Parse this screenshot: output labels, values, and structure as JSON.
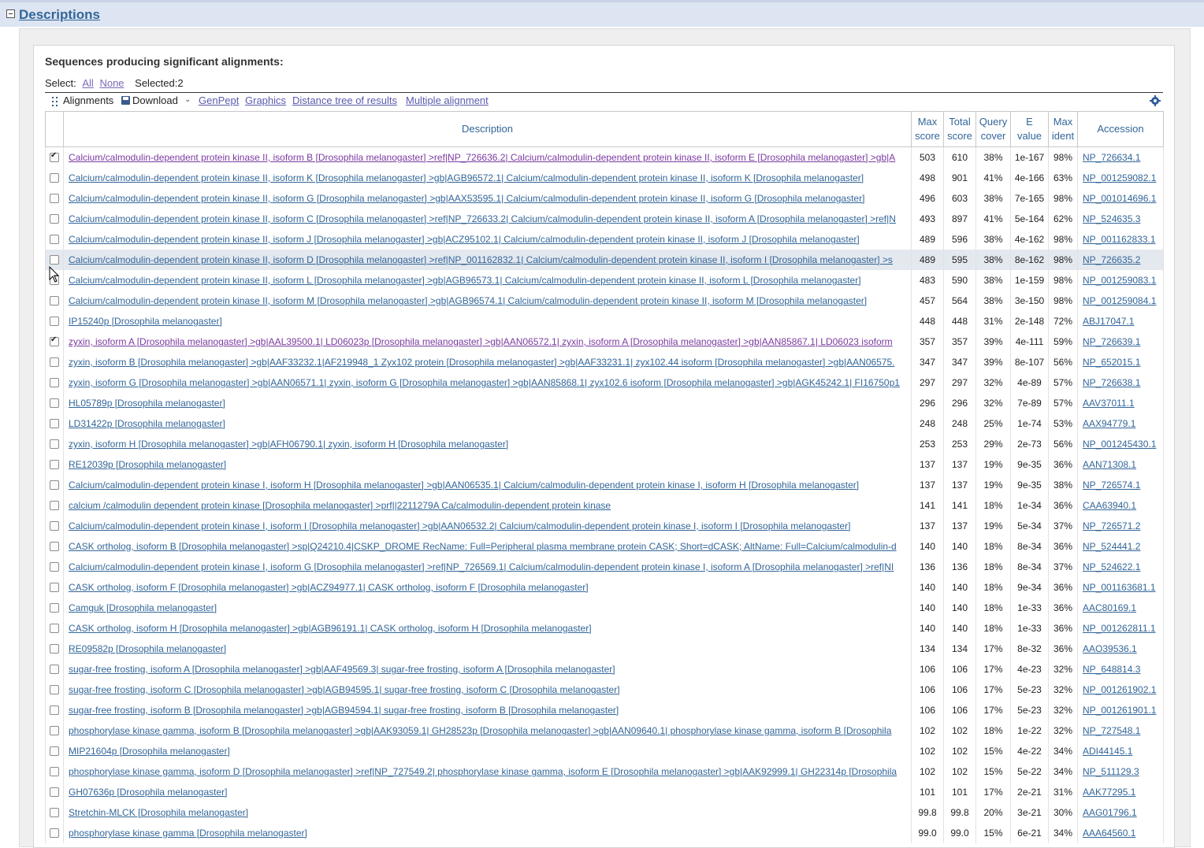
{
  "section": {
    "title": "Descriptions"
  },
  "heading": "Sequences producing significant alignments:",
  "select": {
    "label": "Select:",
    "all": "All",
    "none": "None",
    "selected": "Selected:2"
  },
  "toolbar": {
    "alignments": "Alignments",
    "download": "Download",
    "genpept": "GenPept",
    "graphics": "Graphics",
    "distance_tree": "Distance tree of results",
    "multiple_alignment": "Multiple alignment"
  },
  "columns": {
    "description": "Description",
    "max_score_1": "Max",
    "max_score_2": "score",
    "total_score_1": "Total",
    "total_score_2": "score",
    "query_cover_1": "Query",
    "query_cover_2": "cover",
    "evalue_1": "E",
    "evalue_2": "value",
    "max_ident_1": "Max",
    "max_ident_2": "ident",
    "accession": "Accession"
  },
  "rows": [
    {
      "checked": true,
      "desc": "Calcium/calmodulin-dependent protein kinase II, isoform B [Drosophila melanogaster] >ref|NP_726636.2| Calcium/calmodulin-dependent protein kinase II, isoform E [Drosophila melanogaster] >gb|A",
      "max": "503",
      "total": "610",
      "cover": "38%",
      "e": "1e-167",
      "ident": "98%",
      "acc": "NP_726634.1"
    },
    {
      "checked": false,
      "desc": "Calcium/calmodulin-dependent protein kinase II, isoform K [Drosophila melanogaster] >gb|AGB96572.1| Calcium/calmodulin-dependent protein kinase II, isoform K [Drosophila melanogaster]",
      "max": "498",
      "total": "901",
      "cover": "41%",
      "e": "4e-166",
      "ident": "63%",
      "acc": "NP_001259082.1"
    },
    {
      "checked": false,
      "desc": "Calcium/calmodulin-dependent protein kinase II, isoform G [Drosophila melanogaster] >gb|AAX53595.1| Calcium/calmodulin-dependent protein kinase II, isoform G [Drosophila melanogaster]",
      "max": "496",
      "total": "603",
      "cover": "38%",
      "e": "7e-165",
      "ident": "98%",
      "acc": "NP_001014696.1"
    },
    {
      "checked": false,
      "desc": "Calcium/calmodulin-dependent protein kinase II, isoform C [Drosophila melanogaster] >ref|NP_726633.2| Calcium/calmodulin-dependent protein kinase II, isoform A [Drosophila melanogaster] >ref|N",
      "max": "493",
      "total": "897",
      "cover": "41%",
      "e": "5e-164",
      "ident": "62%",
      "acc": "NP_524635.3"
    },
    {
      "checked": false,
      "desc": "Calcium/calmodulin-dependent protein kinase II, isoform J [Drosophila melanogaster] >gb|ACZ95102.1| Calcium/calmodulin-dependent protein kinase II, isoform J [Drosophila melanogaster]",
      "max": "489",
      "total": "596",
      "cover": "38%",
      "e": "4e-162",
      "ident": "98%",
      "acc": "NP_001162833.1"
    },
    {
      "checked": false,
      "hl": true,
      "desc": "Calcium/calmodulin-dependent protein kinase II, isoform D [Drosophila melanogaster] >ref|NP_001162832.1| Calcium/calmodulin-dependent protein kinase II, isoform I [Drosophila melanogaster] >s",
      "max": "489",
      "total": "595",
      "cover": "38%",
      "e": "8e-162",
      "ident": "98%",
      "acc": "NP_726635.2"
    },
    {
      "checked": false,
      "desc": "Calcium/calmodulin-dependent protein kinase II, isoform L [Drosophila melanogaster] >gb|AGB96573.1| Calcium/calmodulin-dependent protein kinase II, isoform L [Drosophila melanogaster]",
      "max": "483",
      "total": "590",
      "cover": "38%",
      "e": "1e-159",
      "ident": "98%",
      "acc": "NP_001259083.1"
    },
    {
      "checked": false,
      "desc": "Calcium/calmodulin-dependent protein kinase II, isoform M [Drosophila melanogaster] >gb|AGB96574.1| Calcium/calmodulin-dependent protein kinase II, isoform M [Drosophila melanogaster]",
      "max": "457",
      "total": "564",
      "cover": "38%",
      "e": "3e-150",
      "ident": "98%",
      "acc": "NP_001259084.1"
    },
    {
      "checked": false,
      "desc": "IP15240p [Drosophila melanogaster]",
      "max": "448",
      "total": "448",
      "cover": "31%",
      "e": "2e-148",
      "ident": "72%",
      "acc": "ABJ17047.1"
    },
    {
      "checked": true,
      "desc": "zyxin, isoform A [Drosophila melanogaster] >gb|AAL39500.1| LD06023p [Drosophila melanogaster] >gb|AAN06572.1| zyxin, isoform A [Drosophila melanogaster] >gb|AAN85867.1| LD06023 isoform",
      "max": "357",
      "total": "357",
      "cover": "39%",
      "e": "4e-111",
      "ident": "59%",
      "acc": "NP_726639.1"
    },
    {
      "checked": false,
      "desc": "zyxin, isoform B [Drosophila melanogaster] >gb|AAF33232.1|AF219948_1 Zyx102 protein [Drosophila melanogaster] >gb|AAF33231.1| zyx102.44 isoform [Drosophila melanogaster] >gb|AAN06575.",
      "max": "347",
      "total": "347",
      "cover": "39%",
      "e": "8e-107",
      "ident": "56%",
      "acc": "NP_652015.1"
    },
    {
      "checked": false,
      "desc": "zyxin, isoform G [Drosophila melanogaster] >gb|AAN06571.1| zyxin, isoform G [Drosophila melanogaster] >gb|AAN85868.1| zyx102.6 isoform [Drosophila melanogaster] >gb|AGK45242.1| FI16750p1",
      "max": "297",
      "total": "297",
      "cover": "32%",
      "e": "4e-89",
      "ident": "57%",
      "acc": "NP_726638.1"
    },
    {
      "checked": false,
      "desc": "HL05789p [Drosophila melanogaster]",
      "max": "296",
      "total": "296",
      "cover": "32%",
      "e": "7e-89",
      "ident": "57%",
      "acc": "AAV37011.1"
    },
    {
      "checked": false,
      "desc": "LD31422p [Drosophila melanogaster]",
      "max": "248",
      "total": "248",
      "cover": "25%",
      "e": "1e-74",
      "ident": "53%",
      "acc": "AAX94779.1"
    },
    {
      "checked": false,
      "desc": "zyxin, isoform H [Drosophila melanogaster] >gb|AFH06790.1| zyxin, isoform H [Drosophila melanogaster]",
      "max": "253",
      "total": "253",
      "cover": "29%",
      "e": "2e-73",
      "ident": "56%",
      "acc": "NP_001245430.1"
    },
    {
      "checked": false,
      "desc": "RE12039p [Drosophila melanogaster]",
      "max": "137",
      "total": "137",
      "cover": "19%",
      "e": "9e-35",
      "ident": "36%",
      "acc": "AAN71308.1"
    },
    {
      "checked": false,
      "desc": "Calcium/calmodulin-dependent protein kinase I, isoform H [Drosophila melanogaster] >gb|AAN06535.1| Calcium/calmodulin-dependent protein kinase I, isoform H [Drosophila melanogaster]",
      "max": "137",
      "total": "137",
      "cover": "19%",
      "e": "9e-35",
      "ident": "38%",
      "acc": "NP_726574.1"
    },
    {
      "checked": false,
      "desc": "calcium /calmodulin dependent protein kinase [Drosophila melanogaster] >prf||2211279A Ca/calmodulin-dependent protein kinase",
      "max": "141",
      "total": "141",
      "cover": "18%",
      "e": "1e-34",
      "ident": "36%",
      "acc": "CAA63940.1"
    },
    {
      "checked": false,
      "desc": "Calcium/calmodulin-dependent protein kinase I, isoform I [Drosophila melanogaster] >gb|AAN06532.2| Calcium/calmodulin-dependent protein kinase I, isoform I [Drosophila melanogaster]",
      "max": "137",
      "total": "137",
      "cover": "19%",
      "e": "5e-34",
      "ident": "37%",
      "acc": "NP_726571.2"
    },
    {
      "checked": false,
      "desc": "CASK ortholog, isoform B [Drosophila melanogaster] >sp|Q24210.4|CSKP_DROME RecName: Full=Peripheral plasma membrane protein CASK; Short=dCASK; AltName: Full=Calcium/calmodulin-d",
      "max": "140",
      "total": "140",
      "cover": "18%",
      "e": "8e-34",
      "ident": "36%",
      "acc": "NP_524441.2"
    },
    {
      "checked": false,
      "desc": "Calcium/calmodulin-dependent protein kinase I, isoform G [Drosophila melanogaster] >ref|NP_726569.1| Calcium/calmodulin-dependent protein kinase I, isoform A [Drosophila melanogaster] >ref|NI",
      "max": "136",
      "total": "136",
      "cover": "18%",
      "e": "8e-34",
      "ident": "37%",
      "acc": "NP_524622.1"
    },
    {
      "checked": false,
      "desc": "CASK ortholog, isoform F [Drosophila melanogaster] >gb|ACZ94977.1| CASK ortholog, isoform F [Drosophila melanogaster]",
      "max": "140",
      "total": "140",
      "cover": "18%",
      "e": "9e-34",
      "ident": "36%",
      "acc": "NP_001163681.1"
    },
    {
      "checked": false,
      "desc": "Camguk [Drosophila melanogaster]",
      "max": "140",
      "total": "140",
      "cover": "18%",
      "e": "1e-33",
      "ident": "36%",
      "acc": "AAC80169.1"
    },
    {
      "checked": false,
      "desc": "CASK ortholog, isoform H [Drosophila melanogaster] >gb|AGB96191.1| CASK ortholog, isoform H [Drosophila melanogaster]",
      "max": "140",
      "total": "140",
      "cover": "18%",
      "e": "1e-33",
      "ident": "36%",
      "acc": "NP_001262811.1"
    },
    {
      "checked": false,
      "desc": "RE09582p [Drosophila melanogaster]",
      "max": "134",
      "total": "134",
      "cover": "17%",
      "e": "8e-32",
      "ident": "36%",
      "acc": "AAO39536.1"
    },
    {
      "checked": false,
      "desc": "sugar-free frosting, isoform A [Drosophila melanogaster] >gb|AAF49569.3| sugar-free frosting, isoform A [Drosophila melanogaster]",
      "max": "106",
      "total": "106",
      "cover": "17%",
      "e": "4e-23",
      "ident": "32%",
      "acc": "NP_648814.3"
    },
    {
      "checked": false,
      "desc": "sugar-free frosting, isoform C [Drosophila melanogaster] >gb|AGB94595.1| sugar-free frosting, isoform C [Drosophila melanogaster]",
      "max": "106",
      "total": "106",
      "cover": "17%",
      "e": "5e-23",
      "ident": "32%",
      "acc": "NP_001261902.1"
    },
    {
      "checked": false,
      "desc": "sugar-free frosting, isoform B [Drosophila melanogaster] >gb|AGB94594.1| sugar-free frosting, isoform B [Drosophila melanogaster]",
      "max": "106",
      "total": "106",
      "cover": "17%",
      "e": "5e-23",
      "ident": "32%",
      "acc": "NP_001261901.1"
    },
    {
      "checked": false,
      "desc": "phosphorylase kinase gamma, isoform B [Drosophila melanogaster] >gb|AAK93059.1| GH28523p [Drosophila melanogaster] >gb|AAN09640.1| phosphorylase kinase gamma, isoform B [Drosophila",
      "max": "102",
      "total": "102",
      "cover": "18%",
      "e": "1e-22",
      "ident": "32%",
      "acc": "NP_727548.1"
    },
    {
      "checked": false,
      "desc": "MIP21604p [Drosophila melanogaster]",
      "max": "102",
      "total": "102",
      "cover": "15%",
      "e": "4e-22",
      "ident": "34%",
      "acc": "ADI44145.1"
    },
    {
      "checked": false,
      "desc": "phosphorylase kinase gamma, isoform D [Drosophila melanogaster] >ref|NP_727549.2| phosphorylase kinase gamma, isoform E [Drosophila melanogaster] >gb|AAK92999.1| GH22314p [Drosophila",
      "max": "102",
      "total": "102",
      "cover": "15%",
      "e": "5e-22",
      "ident": "34%",
      "acc": "NP_511129.3"
    },
    {
      "checked": false,
      "desc": "GH07636p [Drosophila melanogaster]",
      "max": "101",
      "total": "101",
      "cover": "17%",
      "e": "2e-21",
      "ident": "31%",
      "acc": "AAK77295.1"
    },
    {
      "checked": false,
      "desc": "Stretchin-MLCK [Drosophila melanogaster]",
      "max": "99.8",
      "total": "99.8",
      "cover": "20%",
      "e": "3e-21",
      "ident": "30%",
      "acc": "AAG01796.1"
    },
    {
      "checked": false,
      "desc": "phosphorylase kinase gamma [Drosophila melanogaster]",
      "max": "99.0",
      "total": "99.0",
      "cover": "15%",
      "e": "6e-21",
      "ident": "34%",
      "acc": "AAA64560.1"
    }
  ],
  "colors": {
    "link": "#336699",
    "visited": "#7b3aa0",
    "header_band": "#dde4f2",
    "row_highlight": "#e4e8ef"
  }
}
